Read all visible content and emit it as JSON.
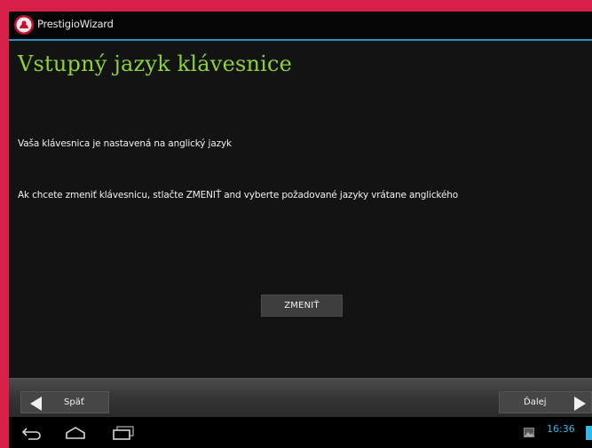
{
  "titlebar": {
    "app_name": "PrestigioWizard"
  },
  "content": {
    "heading": "Vstupný jazyk klávesnice",
    "paragraph1": "Vaša klávesnica je nastavená na anglický jazyk",
    "paragraph2": "Ak chcete zmeniť klávesnicu, stlačte ZMENIŤ and vyberte požadované jazyky vrátane anglického",
    "change_button": "ZMENIŤ"
  },
  "wizard_nav": {
    "back_label": "Späť",
    "next_label": "Ďalej"
  },
  "system_bar": {
    "time": "16:36"
  },
  "colors": {
    "frame": "#d8214a",
    "heading": "#8bd23c",
    "accent": "#33b5e5",
    "titlebar_line": "#2f8fbd"
  },
  "icons": {
    "app": "prestigio-logo-icon",
    "back": "triangle-left-icon",
    "next": "triangle-right-icon",
    "nav_back": "nav-back-icon",
    "nav_home": "nav-home-icon",
    "nav_recents": "nav-recents-icon",
    "notification": "gallery-icon",
    "battery": "battery-icon"
  }
}
